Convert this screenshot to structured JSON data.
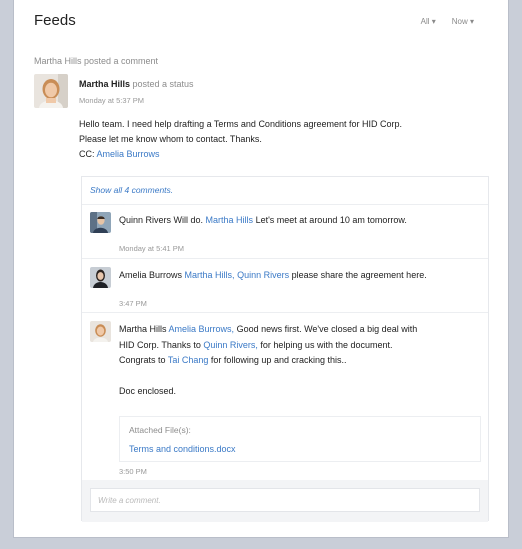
{
  "header": {
    "title": "Feeds",
    "filter_all": "All ▾",
    "filter_now": "Now ▾"
  },
  "activity": {
    "text": "Martha Hills posted a comment"
  },
  "post": {
    "author": "Martha Hills",
    "action": " posted a status",
    "time": "Monday at 5:37 PM",
    "line1": "Hello team. I need help drafting a Terms and Conditions agreement for HID Corp.",
    "line2": "Please let me know whom to contact. Thanks.",
    "cc_label": "CC: ",
    "cc_name": "Amelia Burrows"
  },
  "comments": {
    "show_all": "Show all 4 comments.",
    "items": [
      {
        "author": "Quinn Rivers",
        "t1": " Will do. ",
        "mention": "Martha Hills",
        "t2": " Let's meet at around 10 am tomorrow.",
        "time": "Monday at 5:41 PM"
      },
      {
        "author": "Amelia Burrows",
        "mention1": "Martha Hills,",
        "mention2": "Quinn Rivers",
        "t1": " please share the agreement here.",
        "time": "3:47 PM"
      },
      {
        "author": "Martha Hills",
        "mention1": "Amelia Burrows,",
        "t1": " Good news first. We've closed a big deal with",
        "t2": "HID Corp. Thanks to ",
        "mention2": "Quinn Rivers,",
        "t3": " for helping us with the document.",
        "t4": "Congrats to ",
        "mention3": "Tai Chang",
        "t5": " for following up and cracking this..",
        "t6": "Doc enclosed.",
        "attached_label": "Attached File(s):",
        "attached_file": "Terms and conditions.docx",
        "time": "3:50 PM"
      }
    ],
    "composer_placeholder": "Write a comment."
  },
  "colors": {
    "link": "#3a79c6",
    "backdrop": "#c9ced8"
  }
}
